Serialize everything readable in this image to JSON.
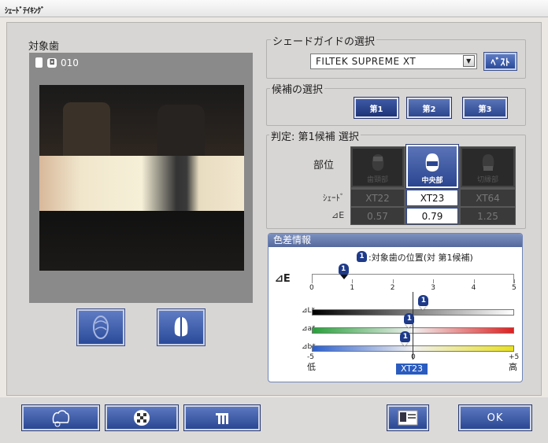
{
  "window": {
    "title": "ｼｪｰﾄﾞﾃｲｷﾝｸﾞ"
  },
  "target_tooth": {
    "label": "対象歯",
    "tooth_id": "010"
  },
  "shade_guide": {
    "group_label": "シェードガイドの選択",
    "selected": "FILTEK SUPREME XT",
    "best_button": "ﾍﾞｽﾄ"
  },
  "candidates": {
    "group_label": "候補の選択",
    "buttons": [
      "第1",
      "第2",
      "第3"
    ],
    "selected_index": 0
  },
  "judgement": {
    "group_label": "判定: 第1候補 選択",
    "region_label": "部位",
    "shade_label": "ｼｪｰﾄﾞ",
    "delta_e_label": "⊿E",
    "regions": [
      {
        "name": "歯頸部",
        "shade": "XT22",
        "delta_e": "0.57",
        "active": false
      },
      {
        "name": "中央部",
        "shade": "XT23",
        "delta_e": "0.79",
        "active": true
      },
      {
        "name": "切縁部",
        "shade": "XT64",
        "delta_e": "1.25",
        "active": false
      }
    ]
  },
  "color_diff": {
    "title": "色差情報",
    "legend_marker": "1",
    "legend_text": ":対象歯の位置(対 第1候補)",
    "de_label": "⊿E",
    "de_ticks": [
      "0",
      "1",
      "2",
      "3",
      "4",
      "5"
    ],
    "de_value": 0.79,
    "axis_rows": [
      {
        "label": "⊿L*",
        "value": 0.5
      },
      {
        "label": "⊿a*",
        "value": -0.2
      },
      {
        "label": "⊿b*",
        "value": -0.4
      }
    ],
    "axis_min": "-5",
    "axis_zero": "0",
    "axis_max": "+5",
    "low_label": "低",
    "high_label": "高",
    "reference_shade": "XT23",
    "colors": {
      "L": [
        "#000000",
        "#ffffff"
      ],
      "a": [
        "#27a13a",
        "#e02020"
      ],
      "b": [
        "#2a5fd0",
        "#e8e020"
      ]
    }
  },
  "bottom": {
    "ok_label": "OK"
  }
}
